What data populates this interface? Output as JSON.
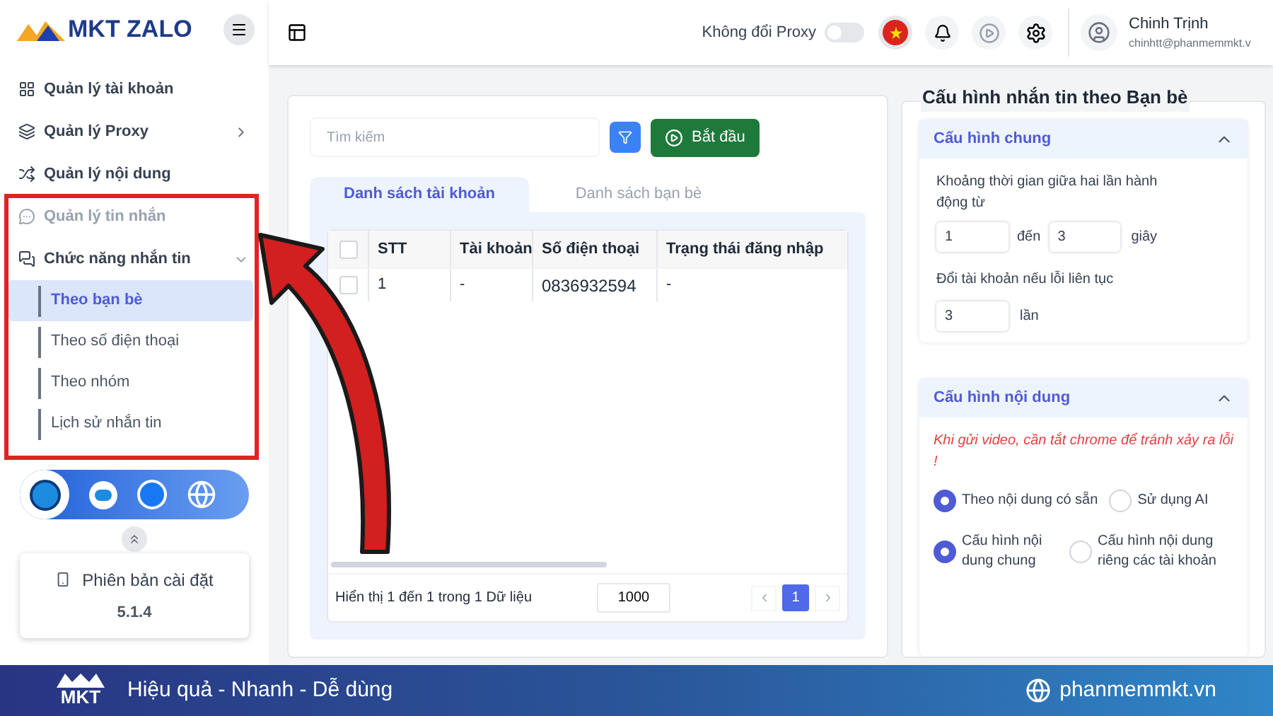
{
  "sidebar": {
    "logo": "MKT ZALO",
    "menu": [
      {
        "label": "Quản lý tài khoản",
        "disabled": false
      },
      {
        "label": "Quản lý Proxy",
        "disabled": false,
        "expanded": false
      },
      {
        "label": "Quản lý nội dung",
        "disabled": false
      },
      {
        "label": "Quản lý tin nhắn",
        "disabled": true
      },
      {
        "label": "Chức năng nhắn tin",
        "disabled": false,
        "expanded": true,
        "children": [
          {
            "label": "Theo bạn bè",
            "selected": true
          },
          {
            "label": "Theo số điện thoại",
            "selected": false
          },
          {
            "label": "Theo nhóm",
            "selected": false
          },
          {
            "label": "Lịch sử nhắn tin",
            "selected": false
          }
        ]
      }
    ],
    "version_card": {
      "label": "Phiên bản cài đặt",
      "version": "5.1.4"
    }
  },
  "header": {
    "proxy_label": "Không đổi Proxy",
    "proxy_on": false,
    "user": {
      "name": "Chinh Trịnh",
      "email": "chinhtt@phanmemmkt.v"
    }
  },
  "main": {
    "search": {
      "placeholder": "Tìm kiếm"
    },
    "start_button": "Bắt đầu",
    "tabs": [
      {
        "label": "Danh sách tài khoản",
        "selected": true
      },
      {
        "label": "Danh sách bạn bè",
        "selected": false
      }
    ],
    "table": {
      "all_checked": false,
      "columns": [
        "STT",
        "Tài khoản",
        "Số điện thoại",
        "Trạng thái đăng nhập"
      ],
      "rows": [
        {
          "checked": false,
          "cells": [
            "1",
            "-",
            "0836932594",
            "-"
          ]
        }
      ]
    },
    "footer": {
      "summary": "Hiển thị 1 đến 1 trong 1 Dữ liệu",
      "page_size": "1000",
      "pages": [
        {
          "label": "1",
          "selected": true
        }
      ]
    }
  },
  "config": {
    "title": "Cấu hình nhắn tin theo Bạn bè",
    "general": {
      "title": "Cấu hình chung",
      "expanded": true,
      "interval_label": "Khoảng thời gian giữa hai lần hành động từ",
      "from": "1",
      "to_label": "đến",
      "to": "3",
      "unit": "giây",
      "switch_label": "Đổi tài khoản nếu lỗi liên tục",
      "switch_value": "3",
      "switch_unit": "lần"
    },
    "content": {
      "title": "Cấu hình nội dung",
      "expanded": true,
      "warning": "Khi gửi video, cần tắt chrome để tránh xảy ra lỗi !",
      "radio_groups": [
        [
          {
            "label": "Theo nội dung có sẵn",
            "selected": true
          },
          {
            "label": "Sử dụng AI",
            "selected": false
          }
        ],
        [
          {
            "label": "Cấu hình nội dung chung",
            "selected": true
          },
          {
            "label": "Cấu hình nội dung riêng các tài khoản",
            "selected": false
          }
        ]
      ]
    }
  },
  "banner": {
    "logo": "MKT",
    "slogan": "Hiệu quả - Nhanh - Dễ dùng",
    "site": "phanmemmkt.vn"
  }
}
